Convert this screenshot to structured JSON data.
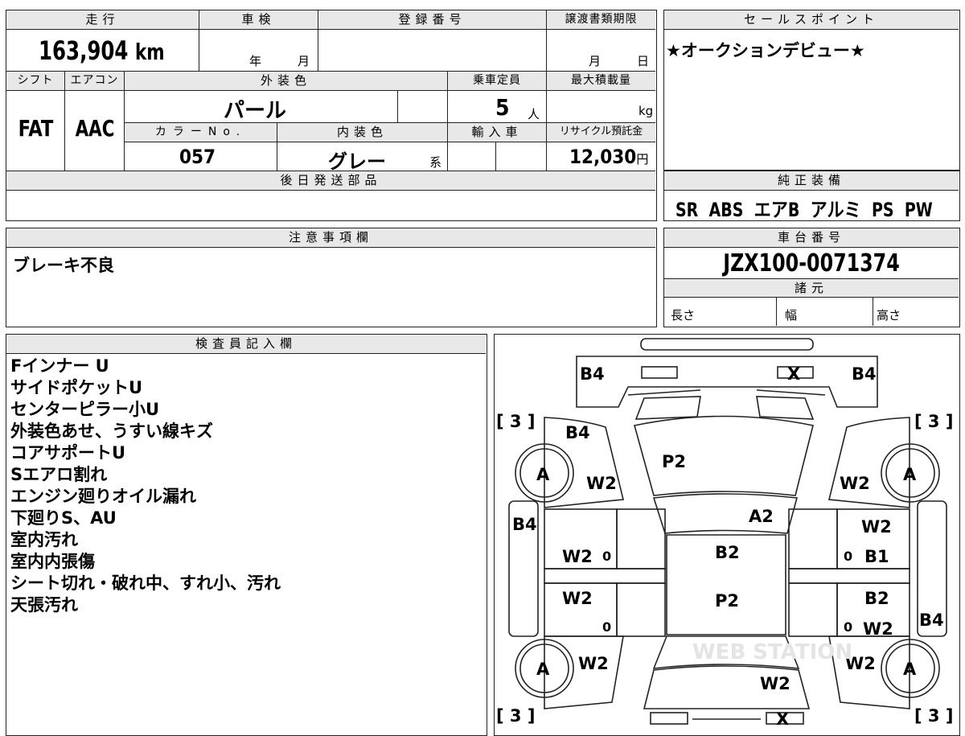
{
  "top": {
    "odometer_label": "走行",
    "odometer_value": "163,904",
    "odometer_unit": "km",
    "inspection_label": "車検",
    "inspection_year": "年",
    "inspection_month": "月",
    "registration_label": "登録番号",
    "transfer_label": "譲渡書類期限",
    "transfer_month": "月",
    "transfer_day": "日",
    "shift_label": "シフト",
    "shift_value": "FAT",
    "ac_label": "エアコン",
    "ac_value": "AAC",
    "exterior_label": "外装色",
    "exterior_value": "パール",
    "capacity_label": "乗車定員",
    "capacity_value": "5",
    "capacity_unit": "人",
    "load_label": "最大積載量",
    "load_unit": "kg",
    "color_no_label": "カラーNo.",
    "color_no_value": "057",
    "interior_label": "内装色",
    "interior_value": "グレー",
    "interior_suffix": "系",
    "import_label": "輸入車",
    "recycle_label": "リサイクル預託金",
    "recycle_value": "12,030",
    "recycle_unit": "円",
    "later_parts_label": "後日発送部品"
  },
  "sales": {
    "label": "セールスポイント",
    "text": "★オークションデビュー★"
  },
  "equipment": {
    "label": "純正装備",
    "items": [
      "SR",
      "ABS",
      "エアB",
      "アルミ",
      "PS",
      "PW"
    ]
  },
  "notes": {
    "label": "注意事項欄",
    "text": "ブレーキ不良"
  },
  "chassis": {
    "label": "車台番号",
    "value": "JZX100-0071374",
    "spec_label": "諸元",
    "length_label": "長さ",
    "width_label": "幅",
    "height_label": "高さ"
  },
  "inspector": {
    "label": "検査員記入欄",
    "lines": [
      "Fインナー U",
      "サイドポケットU",
      "センターピラー小U",
      "外装色あせ、うすい線キズ",
      "コアサポートU",
      "Sエアロ割れ",
      "エンジン廻りオイル漏れ",
      "下廻りS、AU",
      "室内汚れ",
      "室内内張傷",
      "シート切れ・破れ中、すれ小、汚れ",
      "天張汚れ"
    ]
  },
  "diagram": {
    "bracket_tl": "[ 3 ]",
    "bracket_tr": "[ 3 ]",
    "bracket_bl": "[ 3 ]",
    "bracket_br": "[ 3 ]",
    "b4_tl": "B4",
    "b4_tr": "B4",
    "b4_fl": "B4",
    "b4_lside": "B4",
    "b4_rside": "B4",
    "x_top": "X",
    "x_bottom": "X",
    "p2_hood": "P2",
    "p2_roof": "P2",
    "a2": "A2",
    "b2_mid": "B2",
    "w2_lf_fender": "W2",
    "w2_rf_fender": "W2",
    "w2_rf_door": "W2",
    "b1_rf_door": "B1",
    "w2_lf_door": "W2",
    "w2_lr_door": "W2",
    "b2_rr_door": "B2",
    "w2_rr_door": "W2",
    "w2_lr_fender": "W2",
    "w2_rr_fender": "W2",
    "w2_trunk": "W2",
    "tire_a": "A",
    "zero": "0",
    "watermark": "WEB STATION"
  }
}
